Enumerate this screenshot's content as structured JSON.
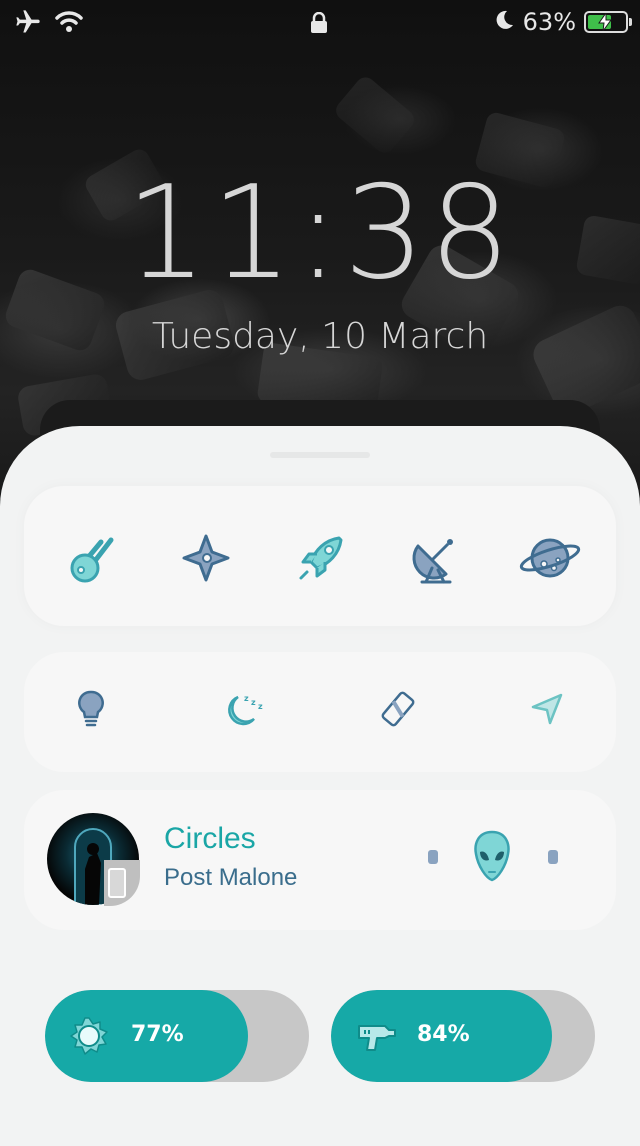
{
  "status_bar": {
    "battery_percent": "63%",
    "battery_level": 0.63,
    "airplane_mode": true,
    "wifi": true,
    "locked": true,
    "do_not_disturb": true,
    "charging": true
  },
  "lockscreen": {
    "time": "11:38",
    "date": "Tuesday, 10 March"
  },
  "control_center": {
    "top_toggles": [
      {
        "icon": "comet-icon",
        "color": "#4fc3c3"
      },
      {
        "icon": "star-ship-icon",
        "color": "#6e8fb0"
      },
      {
        "icon": "rocket-icon",
        "color": "#4fc3c3"
      },
      {
        "icon": "satellite-dish-icon",
        "color": "#6e8fb0"
      },
      {
        "icon": "planet-icon",
        "color": "#6e8fb0"
      }
    ],
    "small_toggles": [
      {
        "icon": "light-bulb-icon"
      },
      {
        "icon": "moon-sleep-icon"
      },
      {
        "icon": "rotation-lock-icon"
      },
      {
        "icon": "location-arrow-icon"
      }
    ],
    "now_playing": {
      "title": "Circles",
      "artist": "Post Malone"
    },
    "sliders": [
      {
        "name": "brightness",
        "icon": "sun-icon",
        "value_label": "77%",
        "level": 0.77
      },
      {
        "name": "volume",
        "icon": "ray-gun-icon",
        "value_label": "84%",
        "level": 0.84
      }
    ]
  },
  "colors": {
    "accent": "#16a9a7",
    "secondary": "#3a6d8c",
    "panel_bg": "#f2f3f3"
  }
}
